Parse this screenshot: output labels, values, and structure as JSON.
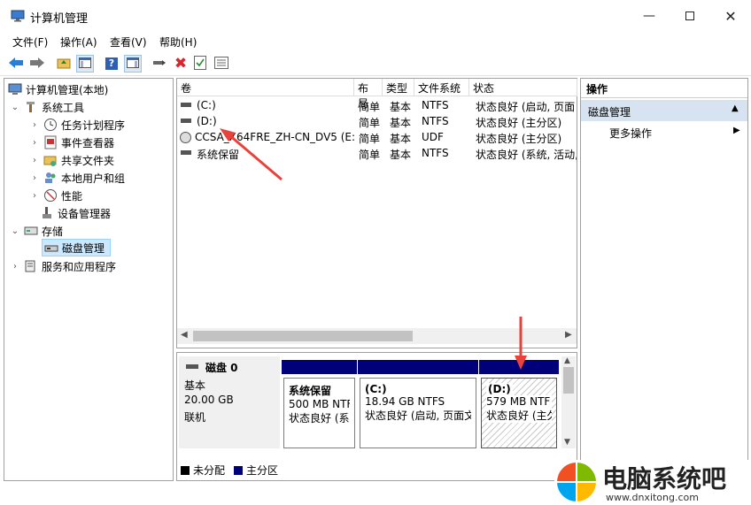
{
  "window": {
    "title": "计算机管理"
  },
  "menu": [
    "文件(F)",
    "操作(A)",
    "查看(V)",
    "帮助(H)"
  ],
  "tree": {
    "root": "计算机管理(本地)",
    "system_tools": "系统工具",
    "task_scheduler": "任务计划程序",
    "event_viewer": "事件查看器",
    "shared_folders": "共享文件夹",
    "local_users": "本地用户和组",
    "performance": "性能",
    "device_manager": "设备管理器",
    "storage": "存储",
    "disk_management": "磁盘管理",
    "services": "服务和应用程序"
  },
  "volumes": {
    "headers": [
      "卷",
      "布局",
      "类型",
      "文件系统",
      "状态"
    ],
    "rows": [
      [
        "(C:)",
        "简单",
        "基本",
        "NTFS",
        "状态良好 (启动, 页面"
      ],
      [
        "(D:)",
        "",
        "",
        "",
        ""
      ],
      [
        "CCSA_X64FRE_ZH-CN_DV5 (E:)",
        "简单",
        "基本",
        "UDF",
        "状态良好 (主分区)"
      ],
      [
        "系统保留",
        "简单",
        "基本",
        "NTFS",
        "状态良好 (系统, 活动,"
      ]
    ],
    "d_row": [
      "简单",
      "基本",
      "NTFS",
      "状态良好 (主分区)"
    ]
  },
  "disk": {
    "name": "磁盘 0",
    "type": "基本",
    "size": "20.00 GB",
    "status": "联机",
    "partitions": [
      {
        "name": "系统保留",
        "size": "500 MB NTF",
        "status": "状态良好 (系"
      },
      {
        "name": "(C:)",
        "size": "18.94 GB NTFS",
        "status": "状态良好 (启动, 页面文"
      },
      {
        "name": "(D:)",
        "size": "579 MB NTF",
        "status": "状态良好 (主久"
      }
    ]
  },
  "legend": {
    "unallocated": "未分配",
    "primary": "主分区"
  },
  "actions": {
    "header": "操作",
    "section": "磁盘管理",
    "more": "更多操作"
  },
  "watermark": {
    "brand": "电脑系统吧",
    "url": "www.dnxitong.com"
  },
  "colors": {
    "primary_partition": "#00007b",
    "selected": "#cce8ff",
    "arrow": "#e8423a"
  }
}
